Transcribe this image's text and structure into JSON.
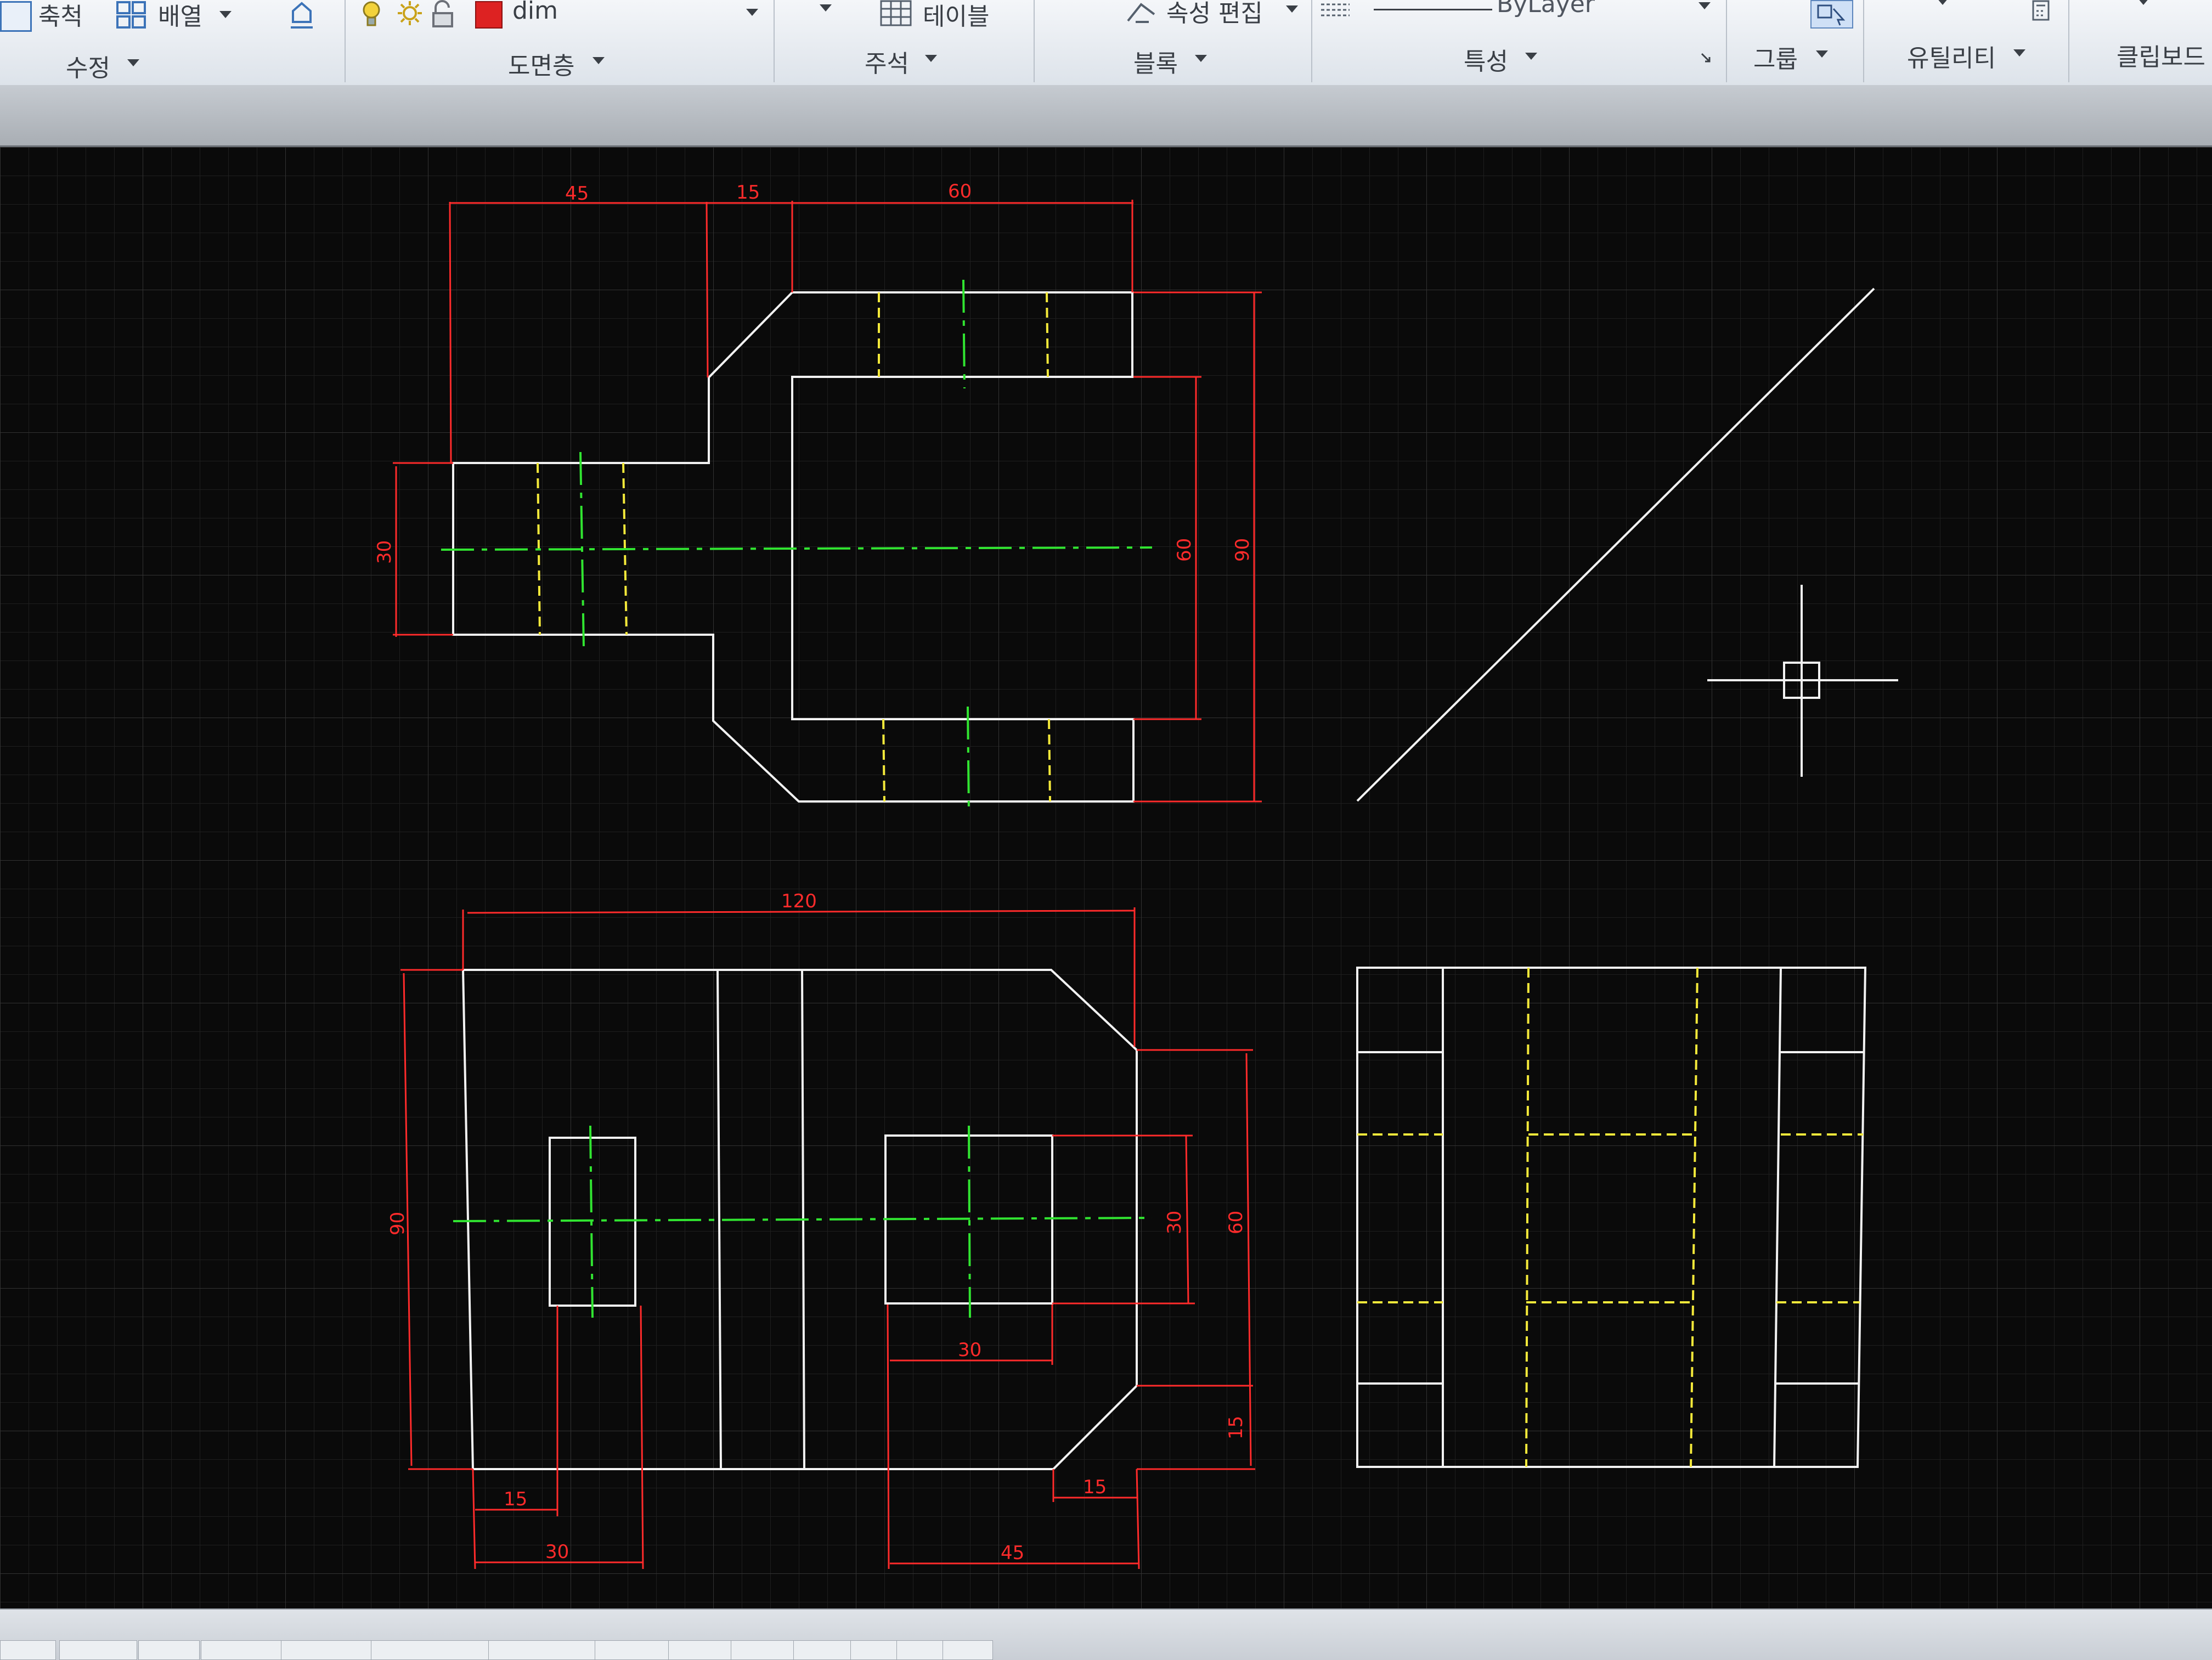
{
  "ribbon": {
    "modify_panel": {
      "scale_label": "축척",
      "array_label": "배열",
      "panel_label": "수정"
    },
    "layers_panel": {
      "current_layer": "dim",
      "layer_color": "#dd2222",
      "panel_label": "도면층"
    },
    "annotation_panel": {
      "table_label": "테이블",
      "panel_label": "주석"
    },
    "block_panel": {
      "edit_attributes_label": "속성 편집",
      "panel_label": "블록"
    },
    "properties_panel": {
      "linetype_value": "ByLayer",
      "panel_label": "특성"
    },
    "groups_panel": {
      "panel_label": "그룹"
    },
    "utilities_panel": {
      "panel_label": "유틸리티"
    },
    "clipboard_panel": {
      "panel_label": "클립보드"
    }
  },
  "drawing": {
    "colors": {
      "background": "#0a0a0a",
      "object_lines": "#f2f2f2",
      "dimensions": "#ff2b2b",
      "center_lines": "#31e531",
      "hidden_lines": "#f4e93a",
      "grid": "#2c2c2c"
    },
    "top_view_dims": {
      "w45": "45",
      "w15": "15",
      "w60": "60",
      "h30": "30",
      "h60": "60",
      "h90": "90"
    },
    "front_view_dims": {
      "w120": "120",
      "h90": "90",
      "h30": "30",
      "h60": "60",
      "h15": "15",
      "w15a": "15",
      "w30a": "30",
      "w30b": "30",
      "w15b": "15",
      "w45": "45"
    }
  },
  "statusbar": {
    "buttons": [
      "",
      "",
      "",
      "",
      "",
      "",
      "",
      "",
      "",
      "",
      "",
      "",
      "",
      ""
    ]
  }
}
